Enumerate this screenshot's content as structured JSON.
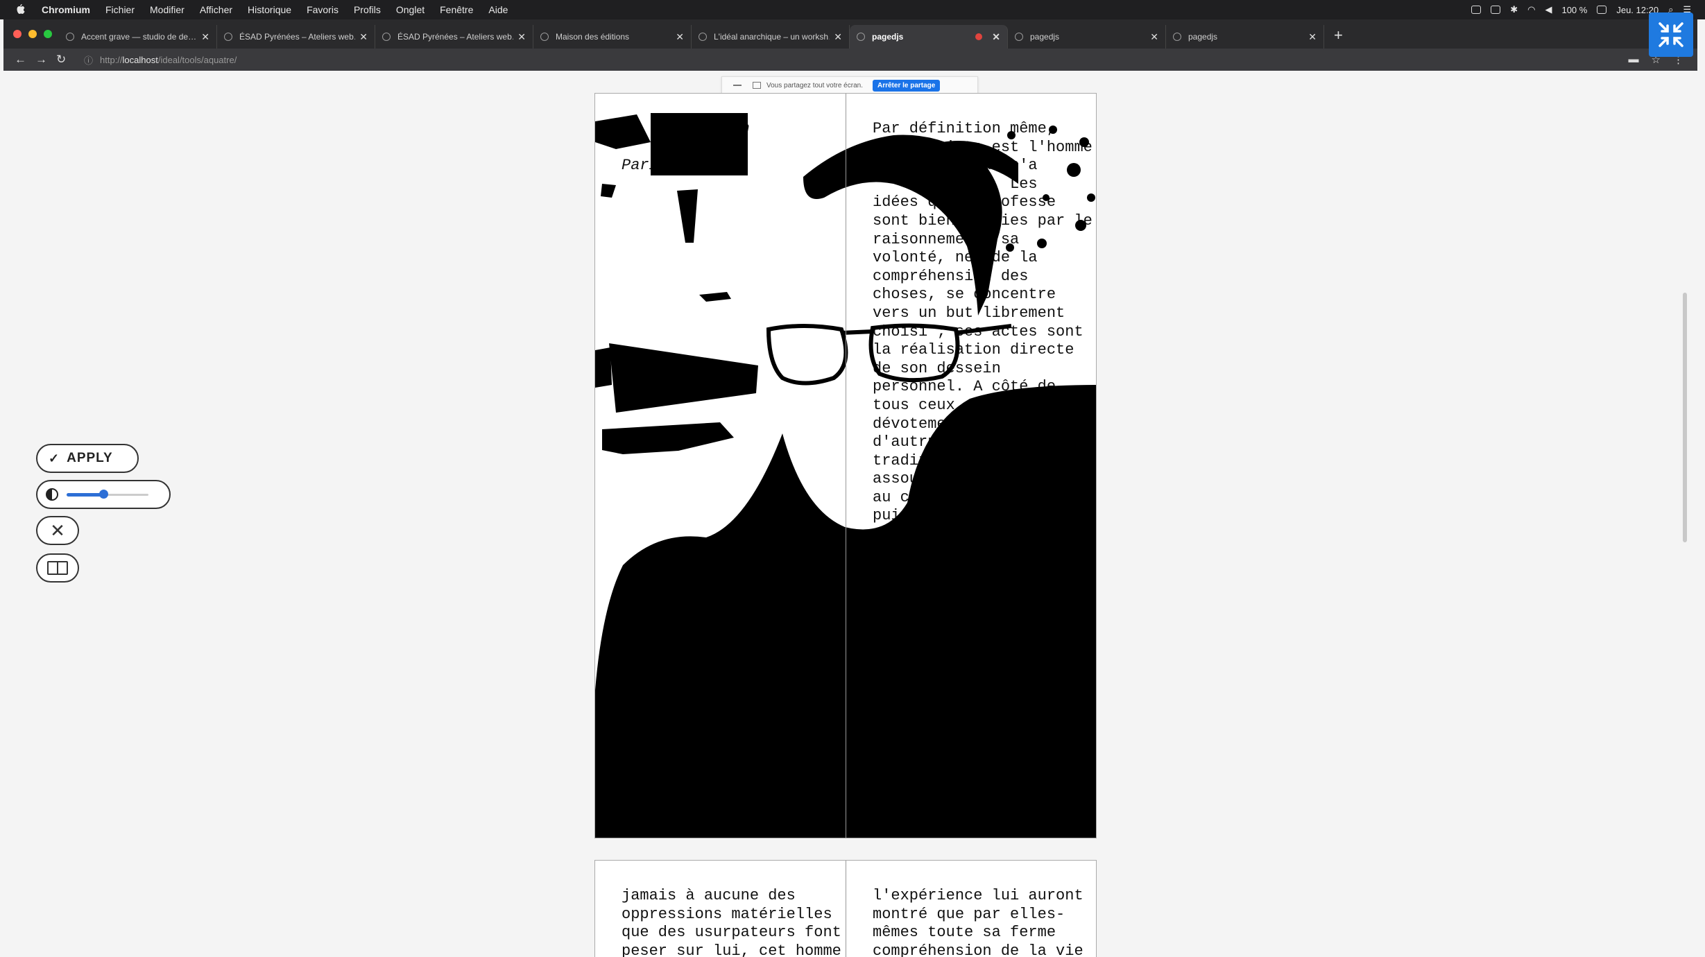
{
  "menubar": {
    "app_name": "Chromium",
    "items": [
      "Fichier",
      "Modifier",
      "Afficher",
      "Historique",
      "Favoris",
      "Profils",
      "Onglet",
      "Fenêtre",
      "Aide"
    ],
    "battery": "100 %",
    "clock": "Jeu. 12:20"
  },
  "tabs": [
    {
      "title": "Accent grave — studio de de…"
    },
    {
      "title": "ÉSAD Pyrénées – Ateliers web…"
    },
    {
      "title": "ÉSAD Pyrénées – Ateliers web…"
    },
    {
      "title": "Maison des éditions"
    },
    {
      "title": "L'idéal anarchique – un worksh…"
    },
    {
      "title": "pagedjs",
      "active": true,
      "recording": true
    },
    {
      "title": "pagedjs"
    },
    {
      "title": "pagedjs"
    }
  ],
  "address": {
    "prefix": "http://",
    "host": "localhost",
    "path": "/ideal/tools/aquatre/"
  },
  "share_bar": {
    "message": "Vous partagez tout votre écran.",
    "stop_label": "Arrêter le partage"
  },
  "tools": {
    "apply_label": "APPLY",
    "contrast_level": 0.45
  },
  "spread_1": {
    "left_text": "           ach\n       1902,\nParis",
    "right_text": "Par définition même,\nl'anarchiste est l'homme\n           qui n'a\n             . Les\nidées qu'il professe\nsont bien saisies par le\nraisonnement, sa\nvolonté, née de la\ncompréhension des\nchoses, se concentre\nvers un but librement\nchoisi ; ses actes sont\nla réalisation directe\nde son dessein\npersonnel. A côté de\ntous ceux qui\ndévotement\nd'autrui\ntradition\nassoupl\nau car\npui"
  },
  "spread_2": {
    "left_text": "jamais à aucune des\noppressions matérielles\nque des usurpateurs font\npeser sur lui, cet homme",
    "right_text": "l'expérience lui auront\nmontré que par elles-\nmêmes toute sa ferme\ncompréhension de la vie"
  },
  "colors": {
    "accent": "#1f7ae0",
    "slider": "#2d6fd6",
    "menubar": "#1f1f21"
  }
}
